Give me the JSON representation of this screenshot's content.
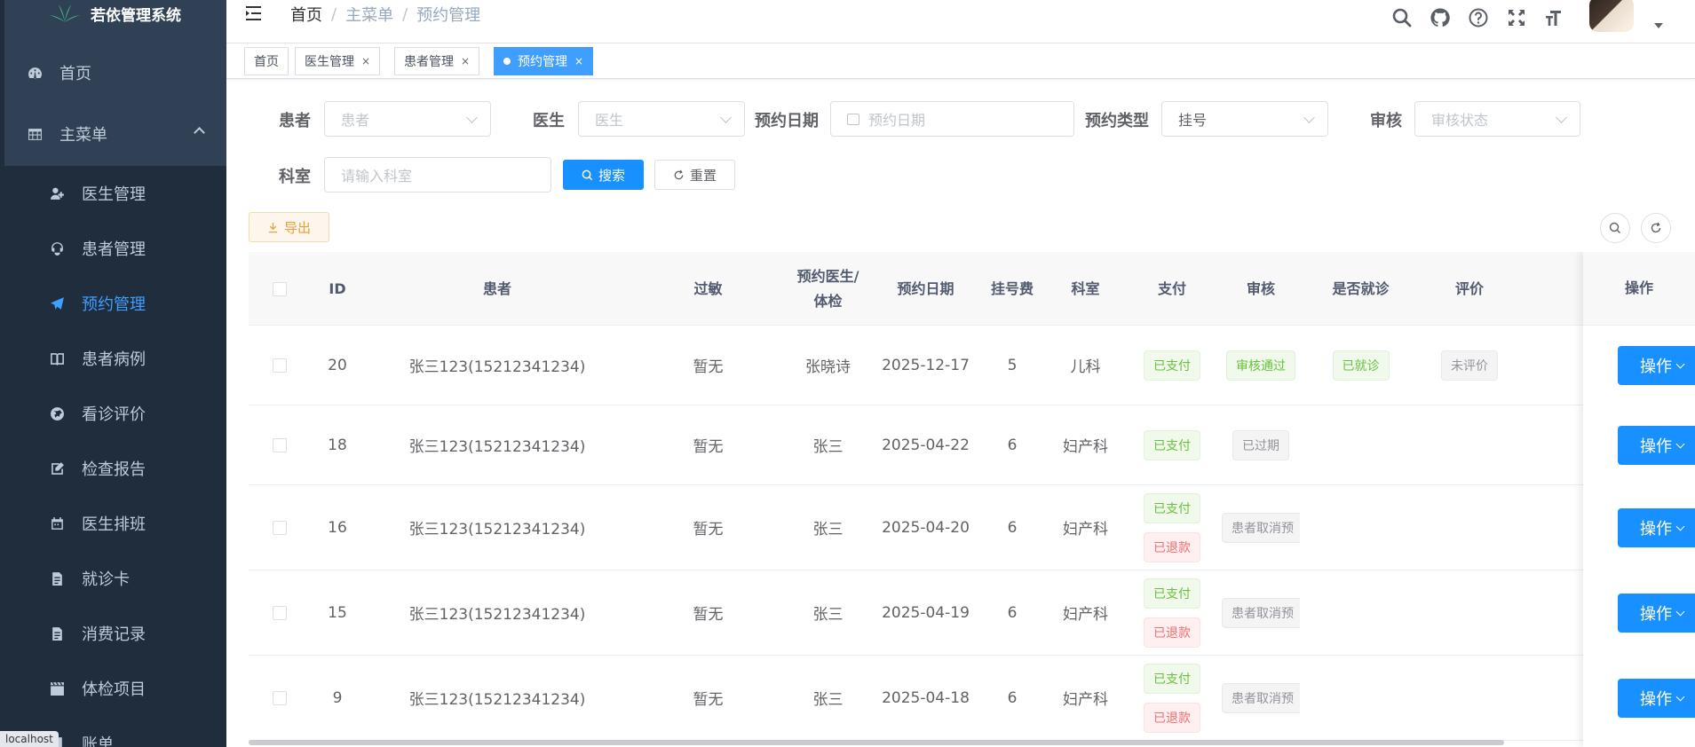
{
  "app": {
    "title": "若依管理系统"
  },
  "sidebar": {
    "home": "首页",
    "main_menu": "主菜单",
    "items": [
      {
        "label": "医生管理",
        "icon": "user-doctor-icon"
      },
      {
        "label": "患者管理",
        "icon": "patient-icon"
      },
      {
        "label": "预约管理",
        "icon": "paper-plane-icon",
        "active": true
      },
      {
        "label": "患者病例",
        "icon": "book-icon"
      },
      {
        "label": "看诊评价",
        "icon": "globe-icon"
      },
      {
        "label": "检查报告",
        "icon": "edit-icon"
      },
      {
        "label": "医生排班",
        "icon": "calendar-icon"
      },
      {
        "label": "就诊卡",
        "icon": "document-icon"
      },
      {
        "label": "消费记录",
        "icon": "document-icon"
      },
      {
        "label": "体检项目",
        "icon": "clapper-icon"
      },
      {
        "label": "账单",
        "icon": "bill-icon"
      }
    ]
  },
  "status_bar": {
    "url": "localhost"
  },
  "breadcrumb": [
    "首页",
    "主菜单",
    "预约管理"
  ],
  "tags": [
    {
      "label": "首页"
    },
    {
      "label": "医生管理"
    },
    {
      "label": "患者管理"
    },
    {
      "label": "预约管理",
      "active": true
    }
  ],
  "search": {
    "patient": {
      "label": "患者",
      "placeholder": "患者"
    },
    "doctor": {
      "label": "医生",
      "placeholder": "医生"
    },
    "date": {
      "label": "预约日期",
      "placeholder": "预约日期"
    },
    "type": {
      "label": "预约类型",
      "value": "挂号"
    },
    "audit": {
      "label": "审核",
      "placeholder": "审核状态"
    },
    "dept": {
      "label": "科室",
      "placeholder": "请输入科室"
    },
    "search_btn": "搜索",
    "reset_btn": "重置",
    "export_btn": "导出"
  },
  "table": {
    "columns": [
      "ID",
      "患者",
      "过敏",
      "预约医生/",
      "体检",
      "预约日期",
      "挂号费",
      "科室",
      "支付",
      "审核",
      "是否就诊",
      "评价",
      "操作"
    ],
    "op_label": "操作",
    "rows": [
      {
        "id": "20",
        "patient": "张三123(15212341234)",
        "allergy": "暂无",
        "doctor": "张晓诗",
        "date": "2025-12-17",
        "fee": "5",
        "dept": "儿科",
        "pay": [
          "已支付"
        ],
        "audit": "审核通过",
        "visited": "已就诊",
        "rating": "未评价"
      },
      {
        "id": "18",
        "patient": "张三123(15212341234)",
        "allergy": "暂无",
        "doctor": "张三",
        "date": "2025-04-22",
        "fee": "6",
        "dept": "妇产科",
        "pay": [
          "已支付"
        ],
        "audit": "已过期",
        "visited": "",
        "rating": ""
      },
      {
        "id": "16",
        "patient": "张三123(15212341234)",
        "allergy": "暂无",
        "doctor": "张三",
        "date": "2025-04-20",
        "fee": "6",
        "dept": "妇产科",
        "pay": [
          "已支付",
          "已退款"
        ],
        "audit": "患者取消预",
        "visited": "",
        "rating": ""
      },
      {
        "id": "15",
        "patient": "张三123(15212341234)",
        "allergy": "暂无",
        "doctor": "张三",
        "date": "2025-04-19",
        "fee": "6",
        "dept": "妇产科",
        "pay": [
          "已支付",
          "已退款"
        ],
        "audit": "患者取消预",
        "visited": "",
        "rating": ""
      },
      {
        "id": "9",
        "patient": "张三123(15212341234)",
        "allergy": "暂无",
        "doctor": "张三",
        "date": "2025-04-18",
        "fee": "6",
        "dept": "妇产科",
        "pay": [
          "已支付",
          "已退款"
        ],
        "audit": "患者取消预",
        "visited": "",
        "rating": ""
      }
    ]
  },
  "colors": {
    "primary": "#1890ff",
    "sidebar_bg": "#304156",
    "sidebar_sub_bg": "#1f2d3d",
    "success": "#67c23a",
    "danger": "#f56c6c"
  }
}
